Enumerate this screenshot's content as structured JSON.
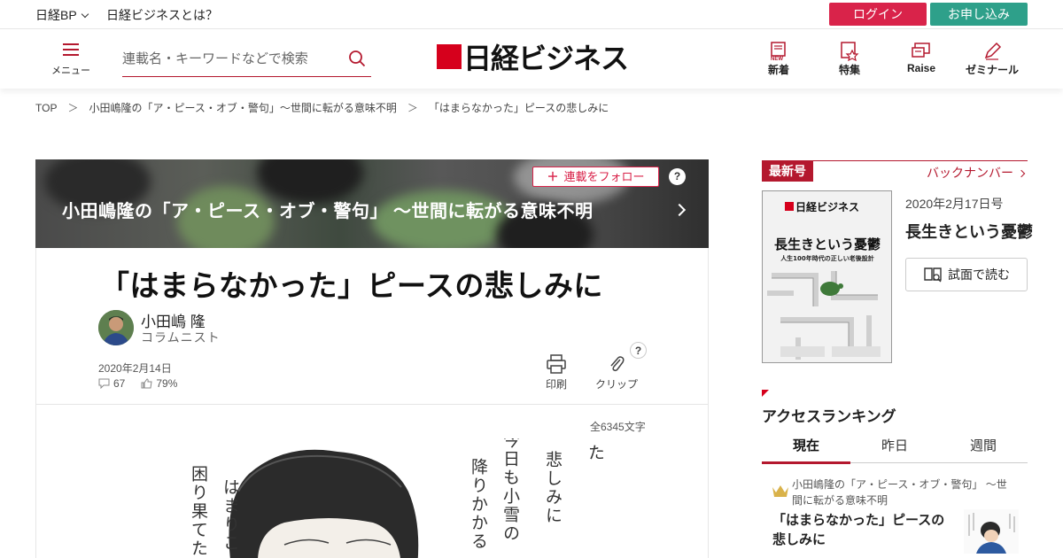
{
  "topbar": {
    "brand_link": "日経BP",
    "about_link": "日経ビジネスとは？",
    "login": "ログイン",
    "apply": "お申し込み"
  },
  "header": {
    "menu_label": "メニュー",
    "search_placeholder": "連載名・キーワードなどで検索",
    "logo_text": "日経ビジネス",
    "nav": [
      {
        "label": "新着",
        "icon": "new-icon"
      },
      {
        "label": "特集",
        "icon": "feature-icon"
      },
      {
        "label": "Raise",
        "icon": "raise-icon"
      },
      {
        "label": "ゼミナール",
        "icon": "pencil-icon"
      }
    ]
  },
  "breadcrumb": {
    "items": [
      "TOP",
      "小田嶋隆の「ア・ピース・オブ・警句」～世間に転がる意味不明",
      "「はまらなかった」ピースの悲しみに"
    ],
    "separator": "＞"
  },
  "series": {
    "title": "小田嶋隆の「ア・ピース・オブ・警句」 ～世間に転がる意味不明",
    "follow_label": "連載をフォロー",
    "help": "?"
  },
  "article": {
    "title": "「はまらなかった」ピースの悲しみに",
    "author": "小田嶋 隆",
    "role": "コラムニスト",
    "date": "2020年2月14日",
    "comments": "67",
    "likes": "79%",
    "print_label": "印刷",
    "clip_label": "クリップ",
    "clip_help": "?",
    "char_count": "全6345文字",
    "illustration_text": [
      "はまらなかった",
      "悲しみに",
      "今日も小雪の",
      "降りかかる",
      "はまりこ",
      "困り果てた"
    ]
  },
  "sidebar": {
    "latest_tag": "最新号",
    "back_numbers": "バックナンバー",
    "issue_date": "2020年2月17日号",
    "issue_title": "長生きという憂鬱",
    "read_button": "試面で読む",
    "cover": {
      "logo": "日経ビジネス",
      "headline": "長生きという憂鬱",
      "subhead": "人生100年時代の正しい老後設計"
    },
    "ranking": {
      "heading": "アクセスランキング",
      "tabs": [
        "現在",
        "昨日",
        "週間"
      ],
      "active_tab": 0,
      "first": {
        "series": "小田嶋隆の「ア・ピース・オブ・警句」 ～世間に転がる意味不明",
        "title": "「はまらなかった」ピースの悲しみに"
      }
    }
  },
  "colors": {
    "accent": "#b4182e",
    "login": "#d9234a",
    "apply": "#2ea08a"
  }
}
